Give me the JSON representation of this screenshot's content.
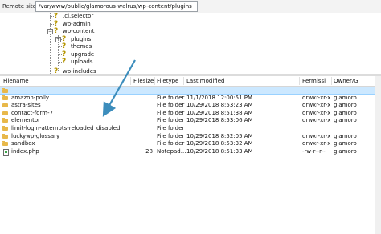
{
  "path_bar": {
    "label": "Remote site:",
    "value": "/var/www/public/glamorous-walrus/wp-content/plugins"
  },
  "tree": {
    "items": [
      {
        "label": ".cl.selector"
      },
      {
        "label": "wp-admin"
      },
      {
        "label": "wp-content"
      },
      {
        "label": "plugins"
      },
      {
        "label": "themes"
      },
      {
        "label": "upgrade"
      },
      {
        "label": "uploads"
      },
      {
        "label": "wp-includes"
      }
    ]
  },
  "columns": [
    "Filename",
    "Filesize",
    "Filetype",
    "Last modified",
    "Permissi",
    "Owner/G"
  ],
  "files": [
    {
      "name": "..",
      "size": "",
      "type": "",
      "modified": "",
      "perms": "",
      "owner": "",
      "icon": "folder"
    },
    {
      "name": "amazon-polly",
      "size": "",
      "type": "File folder",
      "modified": "11/1/2018 12:00:51 PM",
      "perms": "drwxr-xr-x",
      "owner": "glamoro",
      "icon": "folder"
    },
    {
      "name": "astra-sites",
      "size": "",
      "type": "File folder",
      "modified": "10/29/2018 8:53:23 AM",
      "perms": "drwxr-xr-x",
      "owner": "glamoro",
      "icon": "folder"
    },
    {
      "name": "contact-form-7",
      "size": "",
      "type": "File folder",
      "modified": "10/29/2018 8:51:38 AM",
      "perms": "drwxr-xr-x",
      "owner": "glamoro",
      "icon": "folder"
    },
    {
      "name": "elementor",
      "size": "",
      "type": "File folder",
      "modified": "10/29/2018 8:53:06 AM",
      "perms": "drwxr-xr-x",
      "owner": "glamoro",
      "icon": "folder"
    },
    {
      "name": "limit-login-attempts-reloaded_disabled",
      "size": "",
      "type": "File folder",
      "modified": "",
      "perms": "",
      "owner": "",
      "icon": "folder"
    },
    {
      "name": "luckywp-glossary",
      "size": "",
      "type": "File folder",
      "modified": "10/29/2018 8:52:05 AM",
      "perms": "drwxr-xr-x",
      "owner": "glamoro",
      "icon": "folder"
    },
    {
      "name": "sandbox",
      "size": "",
      "type": "File folder",
      "modified": "10/29/2018 8:53:32 AM",
      "perms": "drwxr-xr-x",
      "owner": "glamoro",
      "icon": "folder"
    },
    {
      "name": "index.php",
      "size": "28",
      "type": "Notepad...",
      "modified": "10/29/2018 8:51:33 AM",
      "perms": "-rw-r--r--",
      "owner": "glamoro",
      "icon": "php"
    }
  ],
  "colors": {
    "folder": "#e8b84a",
    "selection": "#cce8ff",
    "arrow": "#3c8dbc",
    "unknown_icon": "#b59500"
  }
}
